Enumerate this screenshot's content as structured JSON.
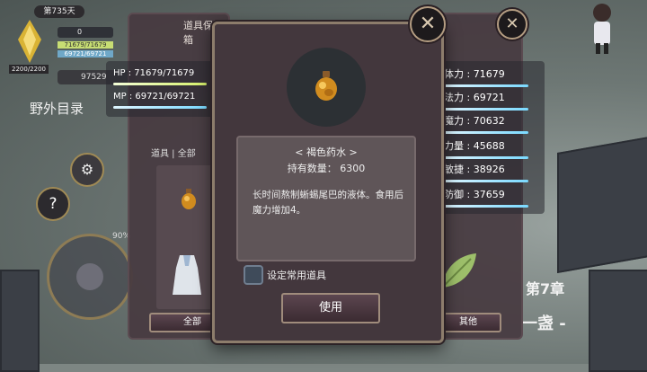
{
  "hud": {
    "day": "第735天",
    "counter": "0",
    "hp_small": "71679/71679",
    "mp_small": "69721/69721",
    "level_box": "2200/2200",
    "gold": "97529",
    "location": "野外目录",
    "percent": "90%"
  },
  "left_panel": {
    "title": "道具保管箱",
    "hp": "HP : 71679/71679",
    "mp": "MP : 69721/69721",
    "tabs_label": "道具 | 全部",
    "bottom_button": "全部"
  },
  "right_panel": {
    "stats": [
      {
        "label": "体力 : 71679"
      },
      {
        "label": "法力 : 69721"
      },
      {
        "label": "魔力 : 70632"
      },
      {
        "label": "力量 : 45688"
      },
      {
        "label": "敏捷 : 38926"
      },
      {
        "label": "防御 : 37659"
      }
    ],
    "bottom_button": "其他"
  },
  "dialog": {
    "item_name": "< 褐色药水 >",
    "quantity": "持有数量： 6300",
    "description": "长时间熬制蜥蜴尾巴的液体。食用后魔力增加4。",
    "checkbox_label": "设定常用道具",
    "use_button": "使用"
  },
  "scene": {
    "chapter": "第7章",
    "chapter_sub": "一盏 -"
  },
  "icons": {
    "close": "close-icon",
    "potion": "potion-icon",
    "help": "help-icon",
    "gear": "gear-icon",
    "dress": "dress-icon",
    "leaf": "leaf-icon"
  }
}
